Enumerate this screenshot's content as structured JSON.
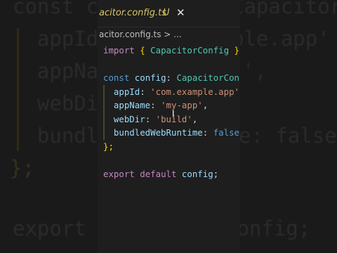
{
  "background": {
    "lines": [
      "const c",
      "  appId",
      "  appNa",
      "  webDi",
      "  bundle",
      "};",
      "",
      "export",
      "",
      "CapacitorConf",
      "ple.app'",
      "',",
      "e: false",
      "config;"
    ]
  },
  "tab": {
    "filename": "acitor.config.ts",
    "status": "U"
  },
  "breadcrumb": {
    "text": "acitor.config.ts > ..."
  },
  "code": {
    "line1": [
      "import",
      "{",
      "CapacitorConfig",
      "}"
    ],
    "line3": [
      "const",
      "config",
      ":",
      "CapacitorCon"
    ],
    "appId": [
      "appId",
      ":",
      "'com.example.app'"
    ],
    "appName": [
      "appName",
      ":",
      "'my-app'"
    ],
    "webDir": [
      "webDir",
      ":",
      "'build'"
    ],
    "bundled": [
      "bundledWebRuntime",
      ":",
      "false"
    ],
    "close": "};",
    "export": [
      "export",
      "default",
      "config",
      ";"
    ]
  },
  "colors": {
    "editor_bg": "#1e1e1e",
    "keyword": "#c586c0",
    "type": "#4ec9b0",
    "string": "#ce9178",
    "variable": "#9cdcfe",
    "modified_tab": "#d7c36a"
  }
}
